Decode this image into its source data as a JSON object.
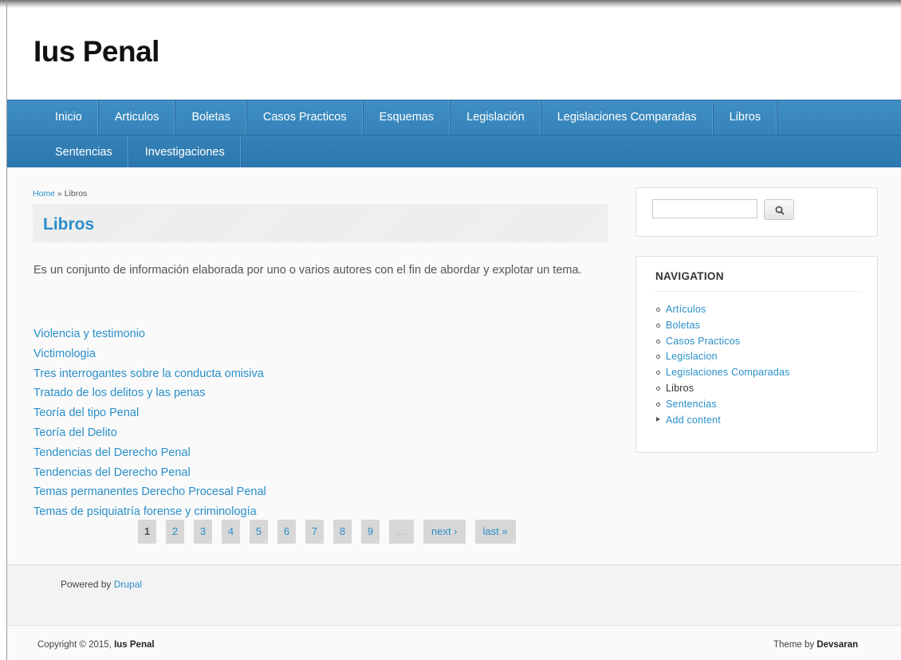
{
  "site": {
    "title": "Ius Penal"
  },
  "nav": {
    "row1": [
      "Inicio",
      "Articulos",
      "Boletas",
      "Casos Practicos",
      "Esquemas",
      "Legislación",
      "Legislaciones Comparadas",
      "Libros"
    ],
    "row2": [
      "Sentencias",
      "Investigaciones"
    ]
  },
  "breadcrumb": {
    "home": "Home",
    "separator": " » ",
    "current": "Libros"
  },
  "page": {
    "title": "Libros",
    "intro": "Es un conjunto de información elaborada por uno o varios autores con el fin de abordar y explotar un tema."
  },
  "books": [
    "Violencia y testimonio",
    "Victimologia",
    "Tres interrogantes sobre la conducta omisiva",
    "Tratado de los delitos y las penas",
    "Teoría del tipo Penal",
    "Teoría del Delito",
    "Tendencias del Derecho Penal",
    "Tendencias del Derecho Penal",
    "Temas permanentes Derecho Procesal Penal",
    "Temas de psiquiatría forense y criminología"
  ],
  "pager": {
    "pages": [
      "1",
      "2",
      "3",
      "4",
      "5",
      "6",
      "7",
      "8",
      "9"
    ],
    "current": "1",
    "ellipsis": "...",
    "next": "next ›",
    "last": "last »"
  },
  "search": {
    "placeholder": "",
    "icon": "search-icon"
  },
  "navigation": {
    "heading": "NAVIGATION",
    "items": [
      {
        "label": "Artículos",
        "active": false,
        "marker": "circle"
      },
      {
        "label": "Boletas",
        "active": false,
        "marker": "circle"
      },
      {
        "label": "Casos Practicos",
        "active": false,
        "marker": "circle"
      },
      {
        "label": "Legislacion",
        "active": false,
        "marker": "circle"
      },
      {
        "label": "Legislaciones Comparadas",
        "active": false,
        "marker": "circle"
      },
      {
        "label": "Libros",
        "active": true,
        "marker": "circle"
      },
      {
        "label": "Sentencias",
        "active": false,
        "marker": "circle"
      },
      {
        "label": "Add content",
        "active": false,
        "marker": "triangle"
      }
    ]
  },
  "footer": {
    "powered_prefix": "Powered by ",
    "powered_link": "Drupal",
    "copyright_prefix": "Copyright © 2015, ",
    "copyright_site": "Ius Penal",
    "theme_prefix": "Theme by ",
    "theme_author": "Devsaran"
  },
  "colors": {
    "accent": "#2a8fc9",
    "nav_bar": "#2c77ad"
  }
}
